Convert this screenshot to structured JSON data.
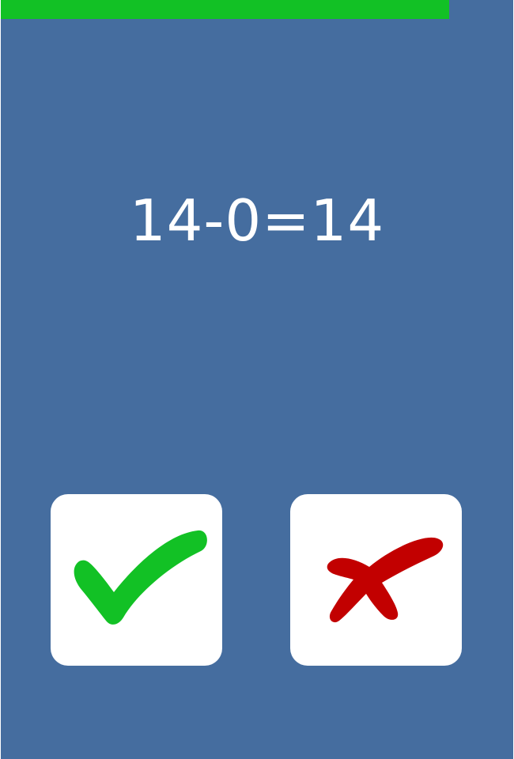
{
  "game": {
    "equation": "14-0=14",
    "timer_remaining": 0.875,
    "timer_color": "#12c125",
    "background_color": "#456d9f"
  },
  "buttons": {
    "correct": {
      "icon": "check-icon",
      "color": "#12c125"
    },
    "wrong": {
      "icon": "cross-icon",
      "color": "#c20000"
    }
  }
}
